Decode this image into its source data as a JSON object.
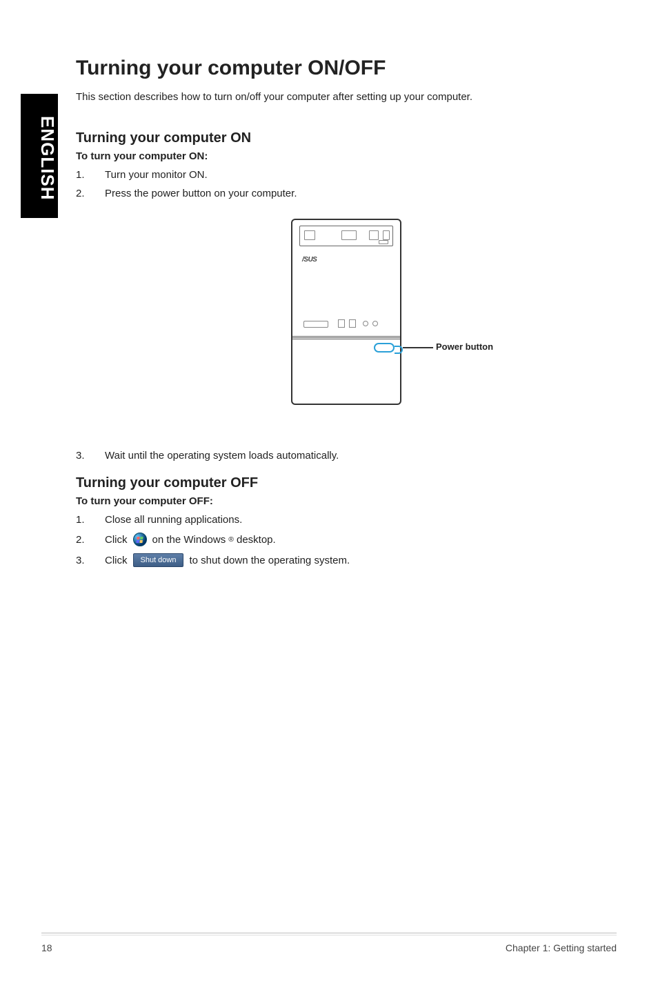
{
  "lang_tab": "ENGLISH",
  "title": "Turning your computer ON/OFF",
  "intro": "This section describes how to turn on/off your computer after setting up your computer.",
  "on": {
    "heading": "Turning your computer ON",
    "subhead": "To turn your computer ON:",
    "steps": {
      "s1": {
        "num": "1.",
        "text": "Turn your monitor ON."
      },
      "s2": {
        "num": "2.",
        "text": "Press the power button on your computer."
      },
      "s3": {
        "num": "3.",
        "text": "Wait until the operating system loads automatically."
      }
    }
  },
  "diagram": {
    "logo_text": "/SUS",
    "power_label": "Power button"
  },
  "off": {
    "heading": "Turning your computer OFF",
    "subhead": "To turn your computer OFF:",
    "steps": {
      "s1": {
        "num": "1.",
        "text": "Close all running applications."
      },
      "s2": {
        "num": "2.",
        "pre": "Click",
        "post_a": " on the Windows",
        "post_b": " desktop."
      },
      "s3": {
        "num": "3.",
        "pre": "Click",
        "btn": "Shut down",
        "post": " to shut down the operating system."
      }
    }
  },
  "footer": {
    "page": "18",
    "chapter": "Chapter 1: Getting started"
  }
}
